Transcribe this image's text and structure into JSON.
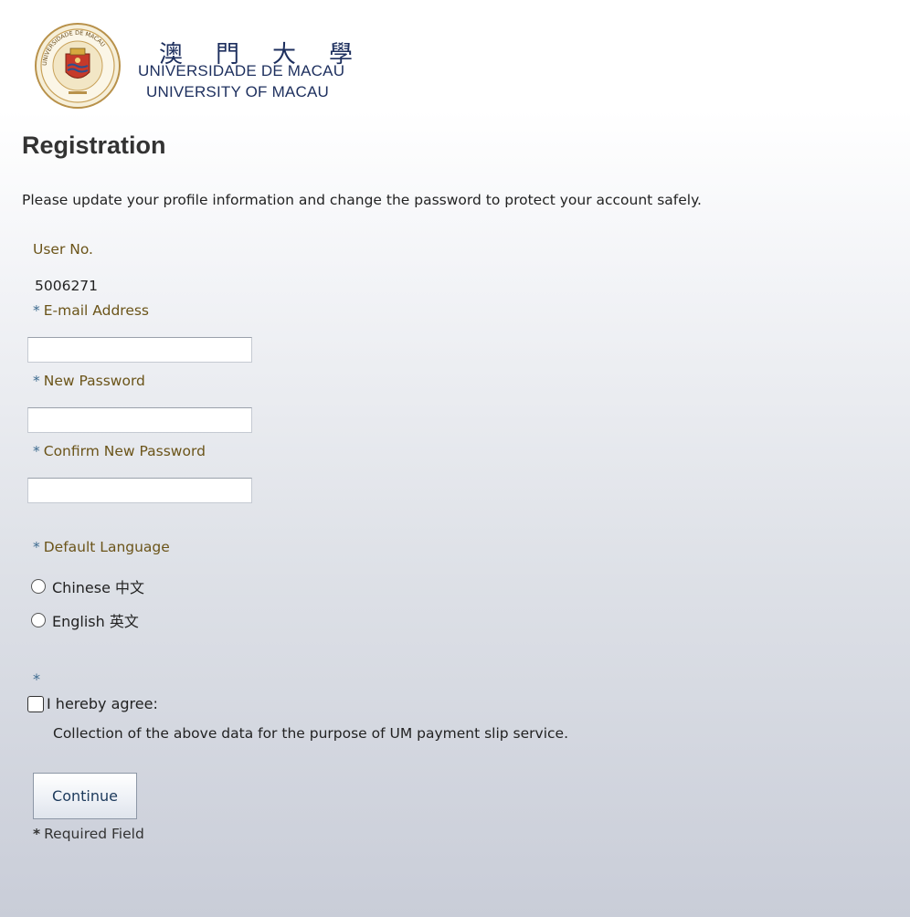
{
  "logo": {
    "chinese_chars": [
      "澳",
      "門",
      "大",
      "學"
    ],
    "portuguese": "UNIVERSIDADE DE MACAU",
    "english": "UNIVERSITY OF MACAU",
    "seal_text": "UNIVERSIDADE DE MACAU"
  },
  "page": {
    "title": "Registration",
    "intro": "Please update your profile information and change the password to protect your account safely."
  },
  "form": {
    "required_marker": "*",
    "user_no_label": "User No.",
    "user_no_value": "5006271",
    "email_label": "E-mail Address",
    "email_value": "",
    "new_password_label": "New Password",
    "new_password_value": "",
    "confirm_password_label": "Confirm New Password",
    "confirm_password_value": "",
    "language_label": "Default Language",
    "language_options": [
      "Chinese 中文",
      "English 英文"
    ],
    "agree_label": "I hereby agree:",
    "agree_description": "Collection of the above data for the purpose of UM payment slip service.",
    "continue_label": "Continue",
    "required_note": "Required Field"
  },
  "colors": {
    "label": "#6b5419",
    "required_star": "#3d6b8f",
    "logo_blue": "#1d2f5e"
  }
}
